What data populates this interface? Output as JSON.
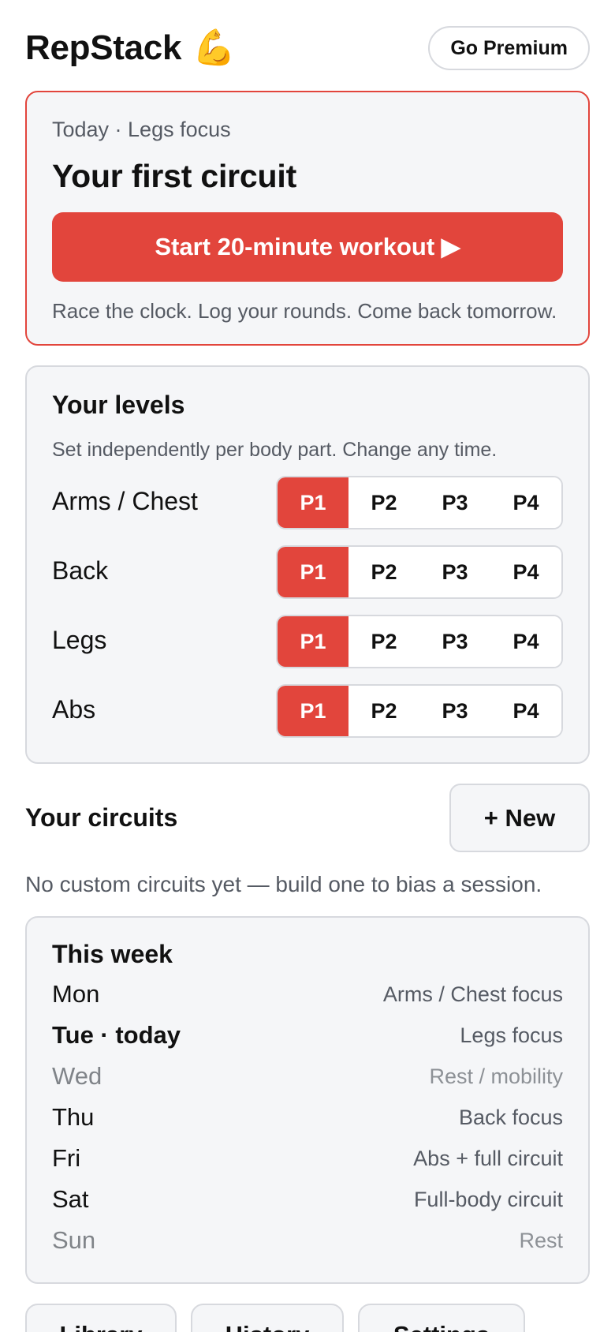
{
  "header": {
    "app_name": "RepStack",
    "app_icon": "💪",
    "premium_label": "Go Premium"
  },
  "today": {
    "subtitle": "Today · Legs focus",
    "title": "Your first circuit",
    "start_label": "Start 20-minute workout ▶",
    "note": "Race the clock. Log your rounds. Come back tomorrow."
  },
  "levels": {
    "title": "Your levels",
    "note": "Set independently per body part. Change any time.",
    "options": [
      "P1",
      "P2",
      "P3",
      "P4"
    ],
    "rows": [
      {
        "label": "Arms / Chest",
        "selected": "P1"
      },
      {
        "label": "Back",
        "selected": "P1"
      },
      {
        "label": "Legs",
        "selected": "P1"
      },
      {
        "label": "Abs",
        "selected": "P1"
      }
    ]
  },
  "circuits": {
    "title": "Your circuits",
    "new_label": "+ New",
    "empty_text": "No custom circuits yet — build one to bias a session."
  },
  "week": {
    "title": "This week",
    "days": [
      {
        "day": "Mon",
        "plan": "Arms / Chest focus",
        "state": "normal"
      },
      {
        "day": "Tue · today",
        "plan": "Legs focus",
        "state": "today"
      },
      {
        "day": "Wed",
        "plan": "Rest / mobility",
        "state": "rest"
      },
      {
        "day": "Thu",
        "plan": "Back focus",
        "state": "normal"
      },
      {
        "day": "Fri",
        "plan": "Abs + full circuit",
        "state": "normal"
      },
      {
        "day": "Sat",
        "plan": "Full-body circuit",
        "state": "normal"
      },
      {
        "day": "Sun",
        "plan": "Rest",
        "state": "rest"
      }
    ]
  },
  "tabs": {
    "library": "Library",
    "history": "History",
    "settings": "Settings"
  },
  "colors": {
    "accent": "#e2453c",
    "card_bg": "#f5f6f8",
    "border": "#d7d9de",
    "muted_text": "#555a63"
  }
}
